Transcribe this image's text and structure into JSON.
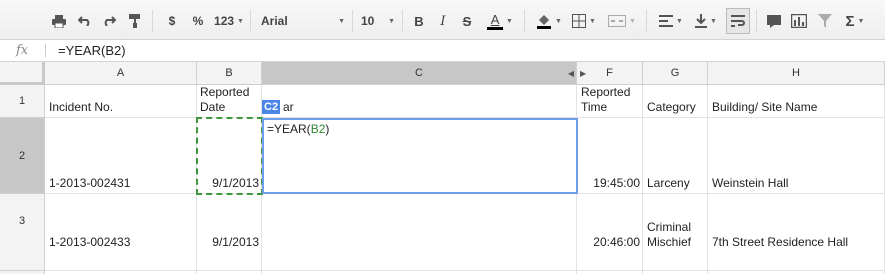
{
  "toolbar": {
    "font_name": "Arial",
    "font_size": "10",
    "currency_label": "$",
    "percent_label": "%",
    "more_formats_label": "123",
    "bold_label": "B",
    "italic_label": "I",
    "strike_label": "S",
    "textcolor_label": "A",
    "sigma_label": "Σ"
  },
  "formula_bar": {
    "fx_label": "fx",
    "content": "=YEAR(B2)"
  },
  "columns": [
    "A",
    "B",
    "C",
    "F",
    "G",
    "H"
  ],
  "rows": [
    "1",
    "2",
    "3"
  ],
  "cells": {
    "A1": "Incident No.",
    "B1": "Reported Date",
    "C1": "ar",
    "F1": "Reported Time",
    "G1": "Category",
    "H1": "Building/ Site Name",
    "A2": "1-2013-002431",
    "B2": "9/1/2013",
    "F2": "19:45:00",
    "G2": "Larceny",
    "H2": "Weinstein Hall",
    "A3": "1-2013-002433",
    "B3": "9/1/2013",
    "F3": "20:46:00",
    "G3": "Criminal Mischief",
    "H3": "7th Street Residence Hall"
  },
  "editor": {
    "badge": "C2",
    "formula_prefix": "=YEAR(",
    "formula_ref": "B2",
    "formula_suffix": ")"
  },
  "colors": {
    "selection": "#4a86e8",
    "copy_marquee": "#3c9a3c",
    "editor_border": "#6d9eeb"
  }
}
